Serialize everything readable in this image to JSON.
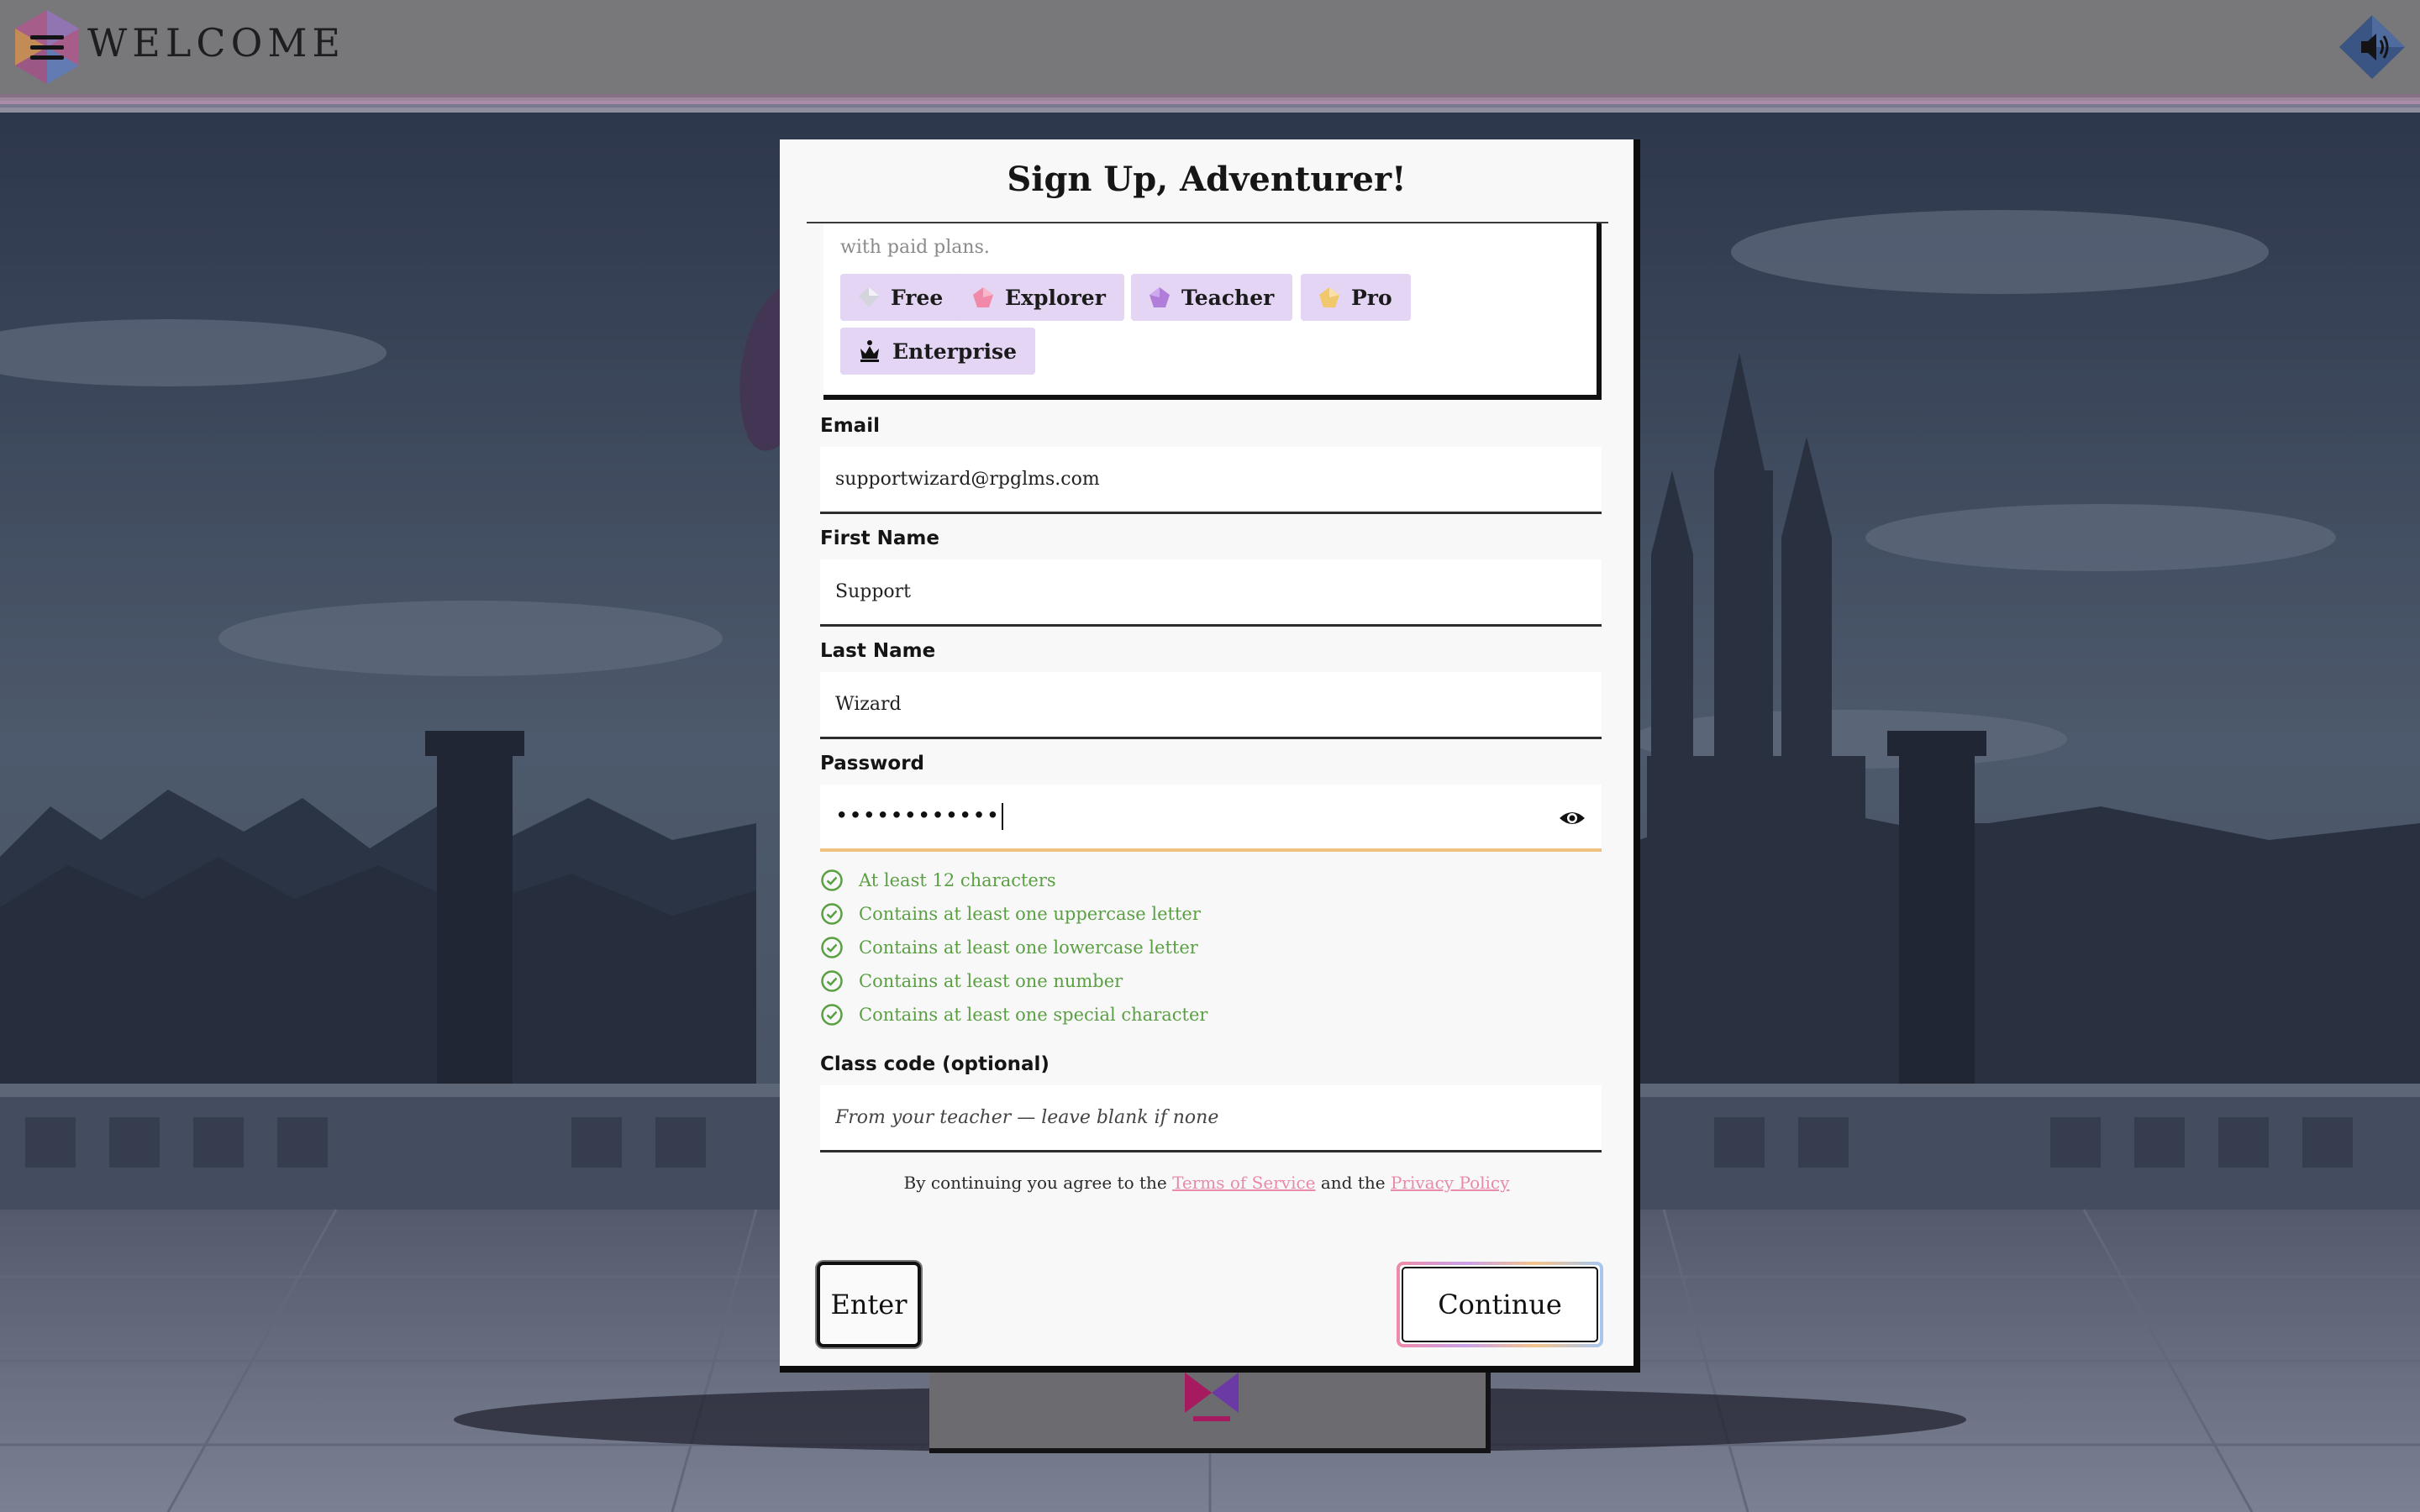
{
  "header": {
    "brand": "WELCOME",
    "menu_icon": "hamburger-menu-icon",
    "sound_icon": "speaker-volume-icon"
  },
  "modal": {
    "title": "Sign Up, Adventurer!",
    "plans_note": "with paid plans.",
    "plans": [
      {
        "label": "Free",
        "icon": "silver-gem-icon",
        "color": "#c9c9d1"
      },
      {
        "label": "Explorer",
        "icon": "pink-gem-icon",
        "color": "#f08aa8"
      },
      {
        "label": "Teacher",
        "icon": "purple-gem-icon",
        "color": "#b07ed8"
      },
      {
        "label": "Pro",
        "icon": "gold-gem-icon",
        "color": "#f2c86e"
      },
      {
        "label": "Enterprise",
        "icon": "crown-icon",
        "color": "#111111"
      }
    ],
    "fields": {
      "email": {
        "label": "Email",
        "value": "supportwizard@rpglms.com"
      },
      "first_name": {
        "label": "First Name",
        "value": "Support"
      },
      "last_name": {
        "label": "Last Name",
        "value": "Wizard"
      },
      "password": {
        "label": "Password",
        "masked_value": "••••••••••••"
      },
      "class_code": {
        "label": "Class code (optional)",
        "placeholder": "From your teacher — leave blank if none"
      }
    },
    "password_rules": [
      "At least 12 characters",
      "Contains at least one uppercase letter",
      "Contains at least one lowercase letter",
      "Contains at least one number",
      "Contains at least one special character"
    ],
    "agreement": {
      "prefix": "By continuing you agree to the",
      "terms_link": "Terms of Service",
      "middle": "and the",
      "privacy_link": "Privacy Policy"
    },
    "buttons": {
      "enter": "Enter",
      "continue": "Continue"
    }
  },
  "colors": {
    "rule_ok": "#5aa043",
    "link": "#e98aa8",
    "chip_bg": "#e3d5f3",
    "focus_underline": "#f0c27f"
  }
}
